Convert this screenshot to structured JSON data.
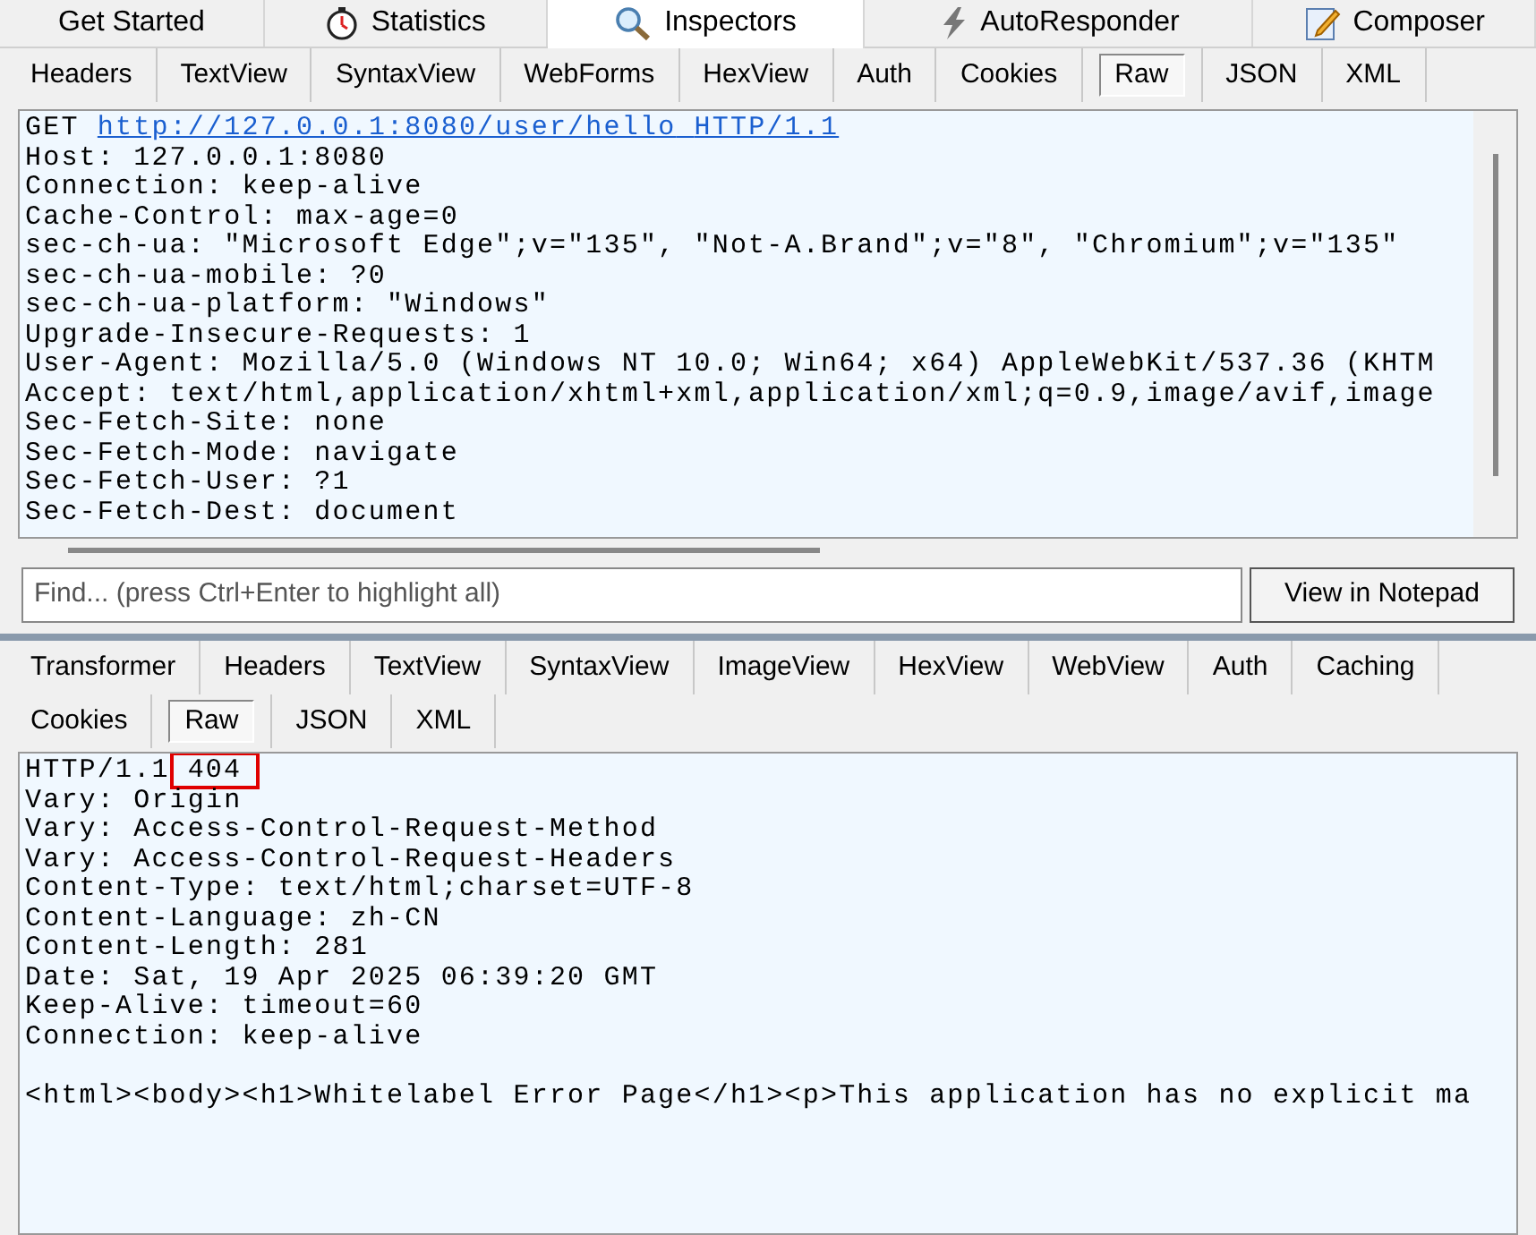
{
  "main_tabs": [
    {
      "label": "Get Started",
      "selected": false
    },
    {
      "label": "Statistics",
      "selected": false
    },
    {
      "label": "Inspectors",
      "selected": true
    },
    {
      "label": "AutoResponder",
      "selected": false
    },
    {
      "label": "Composer",
      "selected": false
    }
  ],
  "request": {
    "tabs": [
      {
        "label": "Headers",
        "selected": false
      },
      {
        "label": "TextView",
        "selected": false
      },
      {
        "label": "SyntaxView",
        "selected": false
      },
      {
        "label": "WebForms",
        "selected": false
      },
      {
        "label": "HexView",
        "selected": false
      },
      {
        "label": "Auth",
        "selected": false
      },
      {
        "label": "Cookies",
        "selected": false
      },
      {
        "label": "Raw",
        "selected": true
      },
      {
        "label": "JSON",
        "selected": false
      },
      {
        "label": "XML",
        "selected": false
      }
    ],
    "method": "GET",
    "url": "http://127.0.0.1:8080/user/hello",
    "version": "HTTP/1.1",
    "lines": [
      "Host: 127.0.0.1:8080",
      "Connection: keep-alive",
      "Cache-Control: max-age=0",
      "sec-ch-ua: \"Microsoft Edge\";v=\"135\", \"Not-A.Brand\";v=\"8\", \"Chromium\";v=\"135\"",
      "sec-ch-ua-mobile: ?0",
      "sec-ch-ua-platform: \"Windows\"",
      "Upgrade-Insecure-Requests: 1",
      "User-Agent: Mozilla/5.0 (Windows NT 10.0; Win64; x64) AppleWebKit/537.36 (KHTM",
      "Accept: text/html,application/xhtml+xml,application/xml;q=0.9,image/avif,image",
      "Sec-Fetch-Site: none",
      "Sec-Fetch-Mode: navigate",
      "Sec-Fetch-User: ?1",
      "Sec-Fetch-Dest: document"
    ],
    "find": {
      "placeholder": "Find... (press Ctrl+Enter to highlight all)"
    },
    "notepad_button": "View in Notepad"
  },
  "response": {
    "tabs": [
      {
        "label": "Transformer",
        "selected": false
      },
      {
        "label": "Headers",
        "selected": false
      },
      {
        "label": "TextView",
        "selected": false
      },
      {
        "label": "SyntaxView",
        "selected": false
      },
      {
        "label": "ImageView",
        "selected": false
      },
      {
        "label": "HexView",
        "selected": false
      },
      {
        "label": "WebView",
        "selected": false
      },
      {
        "label": "Auth",
        "selected": false
      },
      {
        "label": "Caching",
        "selected": false
      },
      {
        "label": "Cookies",
        "selected": false
      },
      {
        "label": "Raw",
        "selected": true
      },
      {
        "label": "JSON",
        "selected": false
      },
      {
        "label": "XML",
        "selected": false
      }
    ],
    "version": "HTTP/1.1",
    "status": "404",
    "status_marked": true,
    "lines": [
      "Vary: Origin",
      "Vary: Access-Control-Request-Method",
      "Vary: Access-Control-Request-Headers",
      "Content-Type: text/html;charset=UTF-8",
      "Content-Language: zh-CN",
      "Content-Length: 281",
      "Date: Sat, 19 Apr 2025 06:39:20 GMT",
      "Keep-Alive: timeout=60",
      "Connection: keep-alive"
    ],
    "body": [
      "<html><body><h1>Whitelabel Error Page</h1><p>This application has no explicit ma"
    ]
  }
}
